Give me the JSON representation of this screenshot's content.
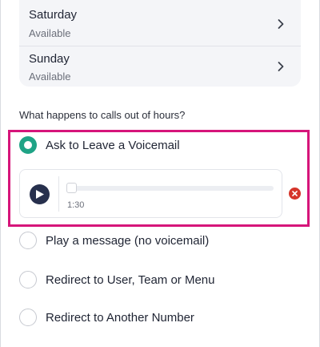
{
  "days": [
    {
      "name": "Saturday",
      "status": "Available"
    },
    {
      "name": "Sunday",
      "status": "Available"
    }
  ],
  "out_of_hours": {
    "question": "What happens to calls out of hours?",
    "options": [
      {
        "label": "Ask to Leave a Voicemail",
        "selected": true
      },
      {
        "label": "Play a message (no voicemail)",
        "selected": false
      },
      {
        "label": "Redirect to User, Team or Menu",
        "selected": false
      },
      {
        "label": "Redirect to Another Number",
        "selected": false
      }
    ]
  },
  "voicemail_player": {
    "duration": "1:30",
    "progress": 0
  },
  "colors": {
    "selected_radio": "#1fa386",
    "highlight_border": "#d6157a",
    "play_button": "#27304d",
    "remove_button": "#d5352b"
  },
  "icons": [
    "chevron-right-icon",
    "play-icon",
    "close-icon"
  ]
}
